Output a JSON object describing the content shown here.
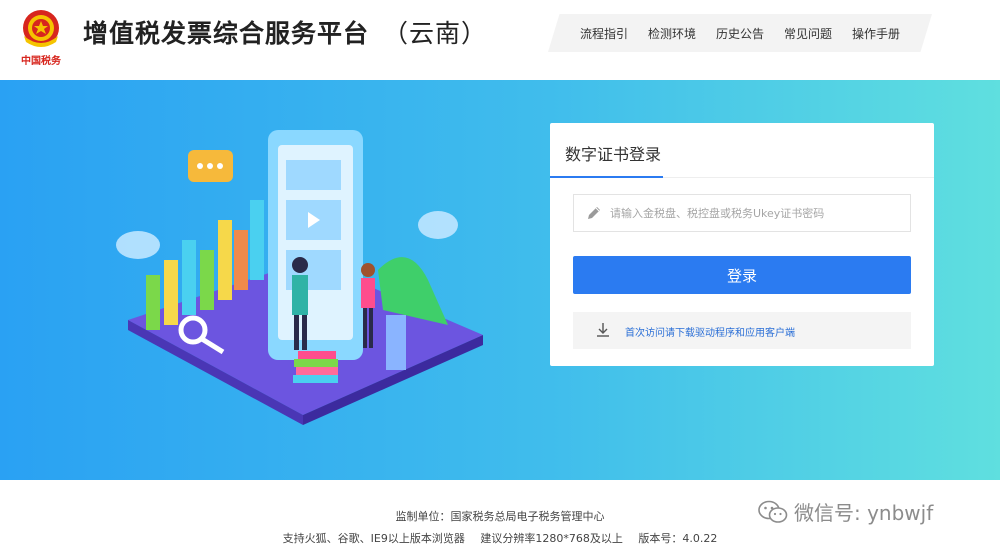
{
  "header": {
    "emblem_caption": "中国税务",
    "title": "增值税发票综合服务平台",
    "region": "（云南）",
    "nav": [
      "流程指引",
      "检测环境",
      "历史公告",
      "常见问题",
      "操作手册"
    ]
  },
  "login": {
    "tab_label": "数字证书登录",
    "password_placeholder": "请输入金税盘、税控盘或税务Ukey证书密码",
    "login_button": "登录",
    "download_link": "首次访问请下载驱动程序和应用客户端"
  },
  "footer": {
    "supervisor": "监制单位：国家税务总局电子税务管理中心",
    "browsers": "支持火狐、谷歌、IE9以上版本浏览器",
    "resolution": "建议分辨率1280*768及以上",
    "version": "版本号：4.0.22"
  },
  "watermark": {
    "text": "微信号: ynbwjf"
  },
  "colors": {
    "accent": "#2b7bf1",
    "banner_start": "#2aa1f3",
    "banner_end": "#5fdfdf",
    "link": "#2b6fd6"
  }
}
